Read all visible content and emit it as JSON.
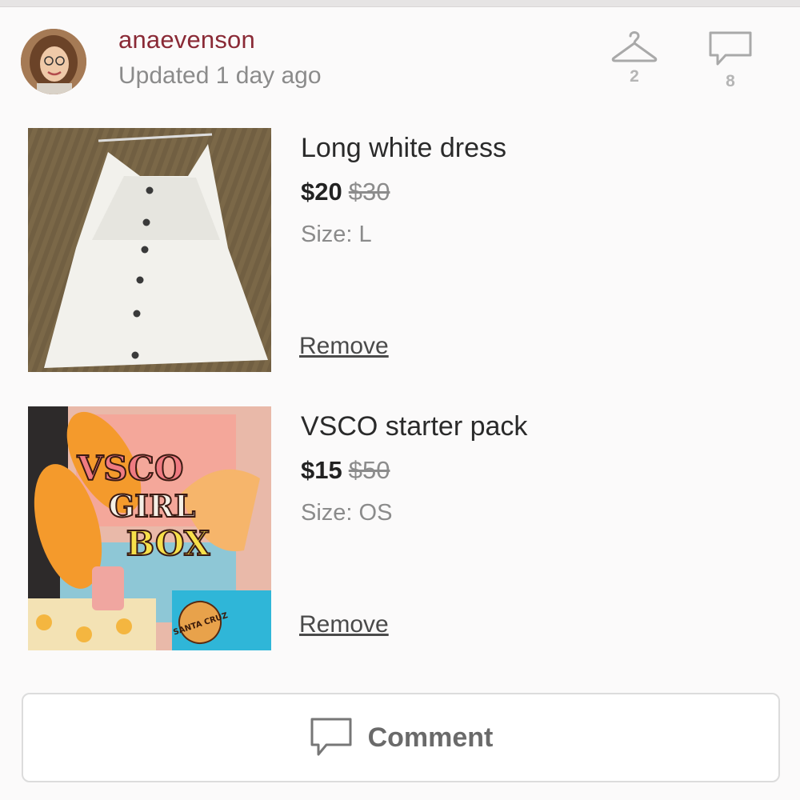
{
  "user": {
    "username": "anaevenson",
    "updated": "Updated 1 day ago"
  },
  "stats": {
    "hanger_icon": "hanger-icon",
    "hanger_count": "2",
    "comment_icon": "speech-bubble-icon",
    "comment_count": "8"
  },
  "items": [
    {
      "title": "Long white dress",
      "price": "$20",
      "original_price": "$30",
      "size": "Size: L",
      "remove_label": "Remove"
    },
    {
      "title": "VSCO starter pack",
      "price": "$15",
      "original_price": "$50",
      "size": "Size: OS",
      "remove_label": "Remove",
      "image_text": [
        "VSCO",
        "GIRL",
        "BOX",
        "SANTA CRUZ"
      ]
    }
  ],
  "comment_button": {
    "label": "Comment",
    "icon": "speech-bubble-icon"
  },
  "colors": {
    "username": "#8a2a36",
    "muted_text": "#8b8b8b",
    "background": "#fbfafa"
  }
}
